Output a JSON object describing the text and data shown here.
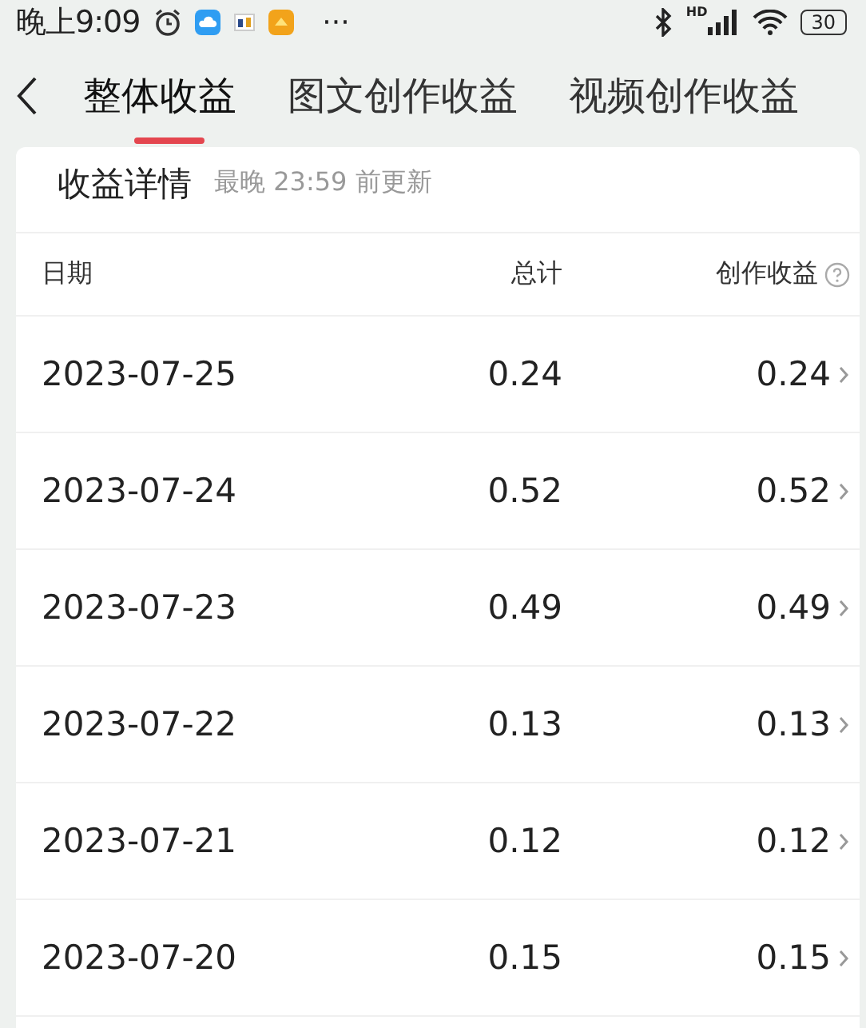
{
  "status_bar": {
    "time": "晚上9:09",
    "more": "···",
    "network": "HD",
    "battery": "30"
  },
  "tabs": [
    {
      "label": "整体收益",
      "selected": true
    },
    {
      "label": "图文创作收益",
      "selected": false
    },
    {
      "label": "视频创作收益",
      "selected": false
    }
  ],
  "card": {
    "title": "收益详情",
    "subtitle": "最晚 23:59 前更新",
    "columns": [
      "日期",
      "总计",
      "创作收益"
    ],
    "rows": [
      {
        "date": "2023-07-25",
        "total": "0.24",
        "creation": "0.24"
      },
      {
        "date": "2023-07-24",
        "total": "0.52",
        "creation": "0.52"
      },
      {
        "date": "2023-07-23",
        "total": "0.49",
        "creation": "0.49"
      },
      {
        "date": "2023-07-22",
        "total": "0.13",
        "creation": "0.13"
      },
      {
        "date": "2023-07-21",
        "total": "0.12",
        "creation": "0.12"
      },
      {
        "date": "2023-07-20",
        "total": "0.15",
        "creation": "0.15"
      }
    ]
  }
}
